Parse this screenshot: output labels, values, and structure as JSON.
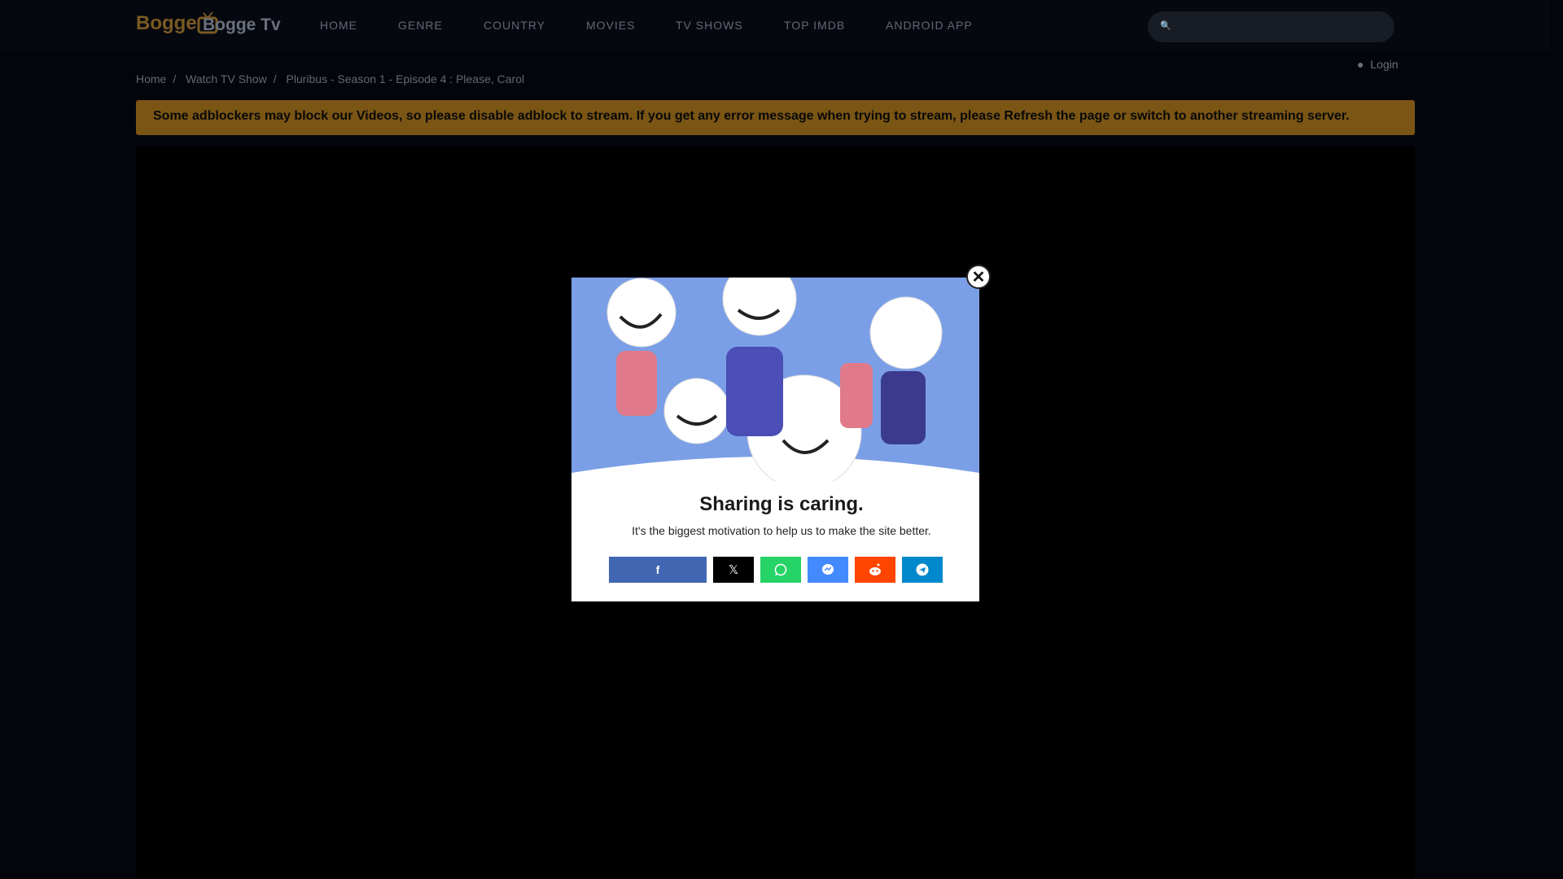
{
  "header": {
    "logo_text": "Bogge",
    "site_title": "Bogge Tv",
    "nav": [
      "HOME",
      "GENRE",
      "COUNTRY",
      "MOVIES",
      "TV SHOWS",
      "TOP IMDB",
      "ANDROID APP"
    ],
    "search_placeholder": "",
    "login": "Login"
  },
  "breadcrumb": [
    "Home",
    "Watch TV Show",
    "Pluribus - Season 1 - Episode 4 : Please, Carol"
  ],
  "notice": "Some adblockers may block our Videos, so please disable adblock to stream. If you get any error message when trying to stream, please Refresh the page or switch to another streaming server.",
  "modal": {
    "title": "Sharing is caring.",
    "subtitle": "It's the biggest motivation to help us to make the site better.",
    "share_buttons": [
      {
        "name": "facebook",
        "color": "#4267b2"
      },
      {
        "name": "x",
        "color": "#000000"
      },
      {
        "name": "whatsapp",
        "color": "#25d366"
      },
      {
        "name": "messenger",
        "color": "#448aff"
      },
      {
        "name": "reddit",
        "color": "#ff4500"
      },
      {
        "name": "telegram",
        "color": "#0088cc"
      }
    ]
  }
}
